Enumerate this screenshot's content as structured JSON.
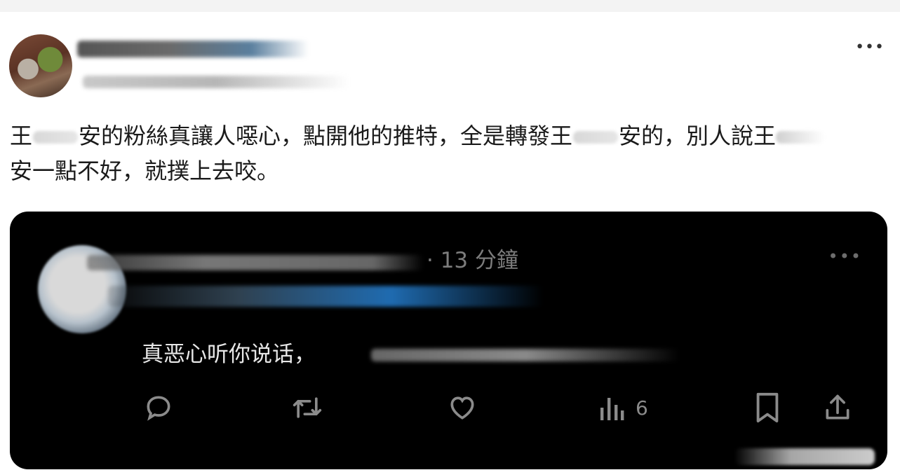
{
  "post": {
    "more_label": "•••",
    "text_line1_a": "王",
    "text_line1_b": "安的粉絲真讓人噁心，點開他的推特，全是轉發王",
    "text_line1_c": "安的，別人說王",
    "text_line2": "安一點不好，就撲上去咬。"
  },
  "embed": {
    "time_label": "· 13 分鐘",
    "more_label": "•••",
    "text_visible": "真恶心听你说话，",
    "actions": {
      "views_count": "6"
    }
  },
  "icons": {
    "reply": "reply-icon",
    "repost": "repost-icon",
    "like": "heart-icon",
    "views": "views-icon",
    "bookmark": "bookmark-icon",
    "share": "share-icon"
  },
  "colors": {
    "page_bg": "#ffffff",
    "embed_bg": "#000000",
    "embed_icon": "#8b8b8b",
    "embed_text": "#e7e7e7",
    "post_text": "#1a1a1a"
  }
}
